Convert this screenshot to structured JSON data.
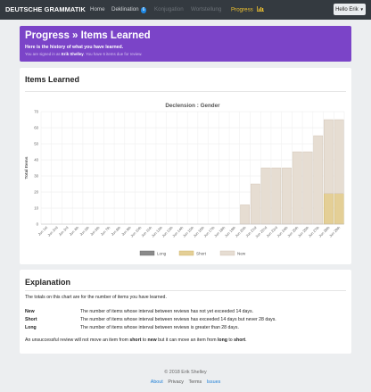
{
  "navbar": {
    "brand": "DEUTSCHE GRAMMATIK",
    "items": [
      {
        "label": "Home",
        "state": "normal"
      },
      {
        "label": "Deklination",
        "state": "normal",
        "badge": "6"
      },
      {
        "label": "Konjugation",
        "state": "disabled"
      },
      {
        "label": "Wortstellung",
        "state": "disabled"
      },
      {
        "label": "Progress",
        "state": "active",
        "icon": "bar-chart-icon"
      }
    ],
    "user_menu": "Hello Erik"
  },
  "banner": {
    "title": "Progress » Items Learned",
    "subtitle": "Here is the history of what you have learned.",
    "info_prefix": "You are signed in as ",
    "user_name": "Erik Shelley",
    "info_suffix": ". You have 6 items due for review."
  },
  "items_card": {
    "title": "Items Learned"
  },
  "chart_data": {
    "type": "bar",
    "stacked": true,
    "title": "Declension : Gender",
    "ylabel": "Total Items",
    "ylim": [
      0,
      70
    ],
    "yticks": [
      0,
      10,
      20,
      30,
      40,
      50,
      60,
      70
    ],
    "grid": true,
    "legend_position": "bottom",
    "categories": [
      "Jun 1st",
      "Jun 2nd",
      "Jun 3rd",
      "Jun 4th",
      "Jun 5th",
      "Jun 6th",
      "Jun 7th",
      "Jun 8th",
      "Jun 9th",
      "Jun 10th",
      "Jun 11th",
      "Jun 12th",
      "Jun 13th",
      "Jun 14th",
      "Jun 15th",
      "Jun 16th",
      "Jun 17th",
      "Jun 18th",
      "Jun 19th",
      "Jun 20th",
      "Jun 21st",
      "Jun 22nd",
      "Jun 23rd",
      "Jun 24th",
      "Jun 25th",
      "Jun 26th",
      "Jun 27th",
      "Jun 28th",
      "Jun 29th"
    ],
    "series": [
      {
        "name": "Long",
        "color": "#8a8a8a",
        "values": [
          0,
          0,
          0,
          0,
          0,
          0,
          0,
          0,
          0,
          0,
          0,
          0,
          0,
          0,
          0,
          0,
          0,
          0,
          0,
          0,
          0,
          0,
          0,
          0,
          0,
          0,
          0,
          0,
          0
        ]
      },
      {
        "name": "Short",
        "color": "#e4cf96",
        "values": [
          0,
          0,
          0,
          0,
          0,
          0,
          0,
          0,
          0,
          0,
          0,
          0,
          0,
          0,
          0,
          0,
          0,
          0,
          0,
          0,
          0,
          0,
          0,
          0,
          0,
          0,
          0,
          19,
          19
        ]
      },
      {
        "name": "New",
        "color": "#e6ddd2",
        "values": [
          0,
          0,
          0,
          0,
          0,
          0,
          0,
          0,
          0,
          0,
          0,
          0,
          0,
          0,
          0,
          0,
          0,
          0,
          0,
          12,
          25,
          35,
          35,
          35,
          45,
          45,
          55,
          46,
          46
        ]
      }
    ]
  },
  "explanation": {
    "title": "Explanation",
    "intro": "The totals on this chart are for the number of items you have learned.",
    "rows": [
      {
        "term": "New",
        "desc": "The number of items whose interval between reviews has not yet exceeded 14 days."
      },
      {
        "term": "Short",
        "desc": "The number of items whose interval between reviews has exceeded 14 days but never 28 days."
      },
      {
        "term": "Long",
        "desc": "The number of items whose interval between reviews is greater than 28 days."
      }
    ],
    "note": {
      "part1": "An unsuccessful review will not move an item from ",
      "from1": "short",
      "part2": " to ",
      "to1": "new",
      "part3": " but it can move an item from ",
      "from2": "long",
      "part4": " to ",
      "to2": "short",
      "part5": "."
    }
  },
  "footer": {
    "copyright": "© 2018 Erik Shelley",
    "links": [
      "About",
      "Privacy",
      "Terms",
      "Issues"
    ]
  },
  "colors": {
    "navbar": "#343a40",
    "banner": "#7b44c8",
    "active_nav": "#f0c330",
    "link": "#1e7fd6"
  }
}
